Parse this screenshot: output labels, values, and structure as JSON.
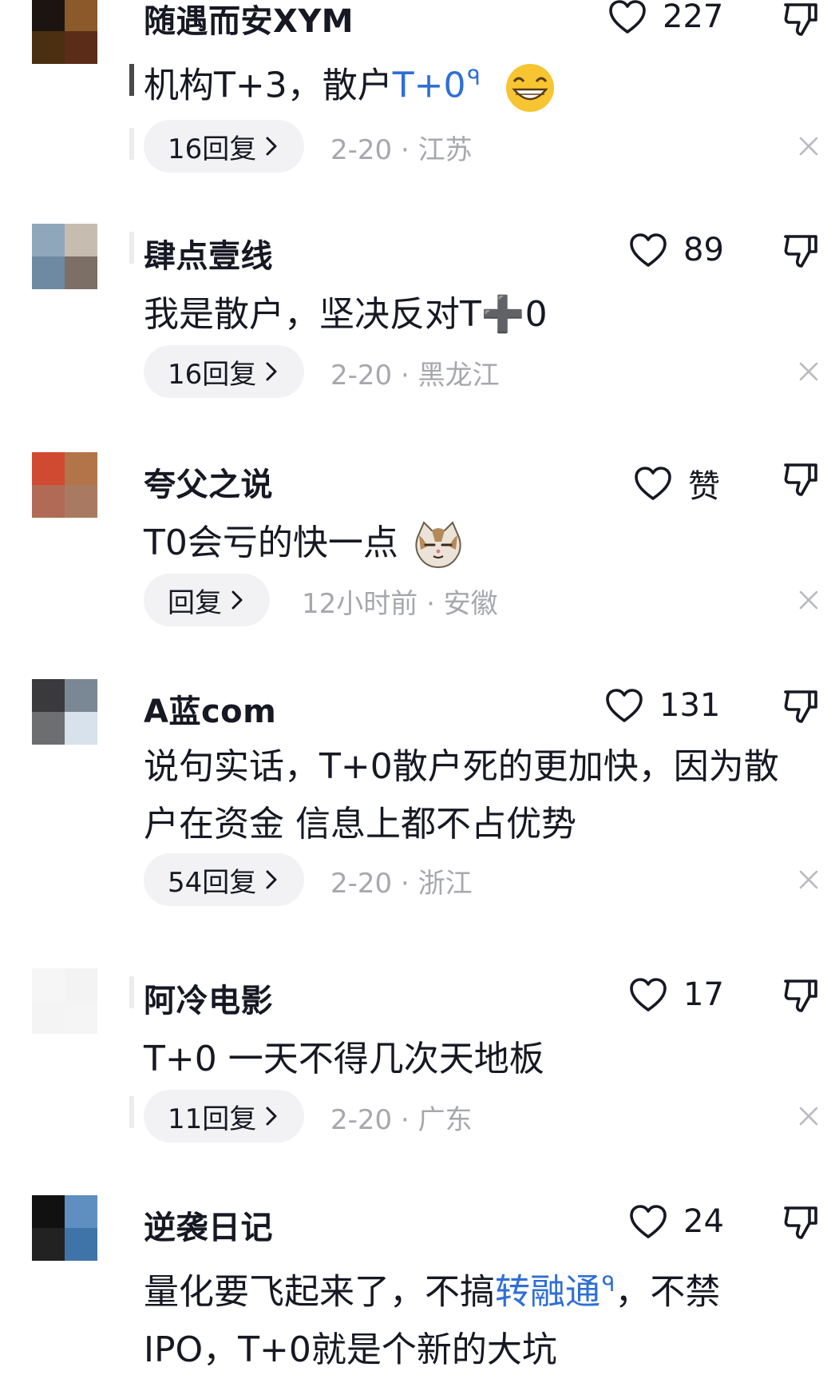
{
  "comments": [
    {
      "username": "随遇而安XYM",
      "likes": "227",
      "text_parts": [
        "机构T+3，散户",
        "T+0"
      ],
      "text_search_mark": "ᑫ",
      "replies": "16回复",
      "date": "2-20 · 江苏",
      "avatar_colors": [
        "#1b1410",
        "#8a5a2a",
        "#4a3010",
        "#5b2d18"
      ],
      "emoji": "grinning-face"
    },
    {
      "username": "肆点壹线",
      "likes": "89",
      "text": "我是散户，坚决反对T➕0",
      "replies": "16回复",
      "date": "2-20 · 黑龙江",
      "avatar_colors": [
        "#8fa7bb",
        "#c6bcb0",
        "#6e8aa3",
        "#7b6f66"
      ]
    },
    {
      "username": "夸父之说",
      "likes": "赞",
      "text": "T0会亏的快一点",
      "replies": "回复",
      "date": "12小时前 · 安徽",
      "avatar_colors": [
        "#d04a32",
        "#b2754a",
        "#b06a55",
        "#a97a62"
      ],
      "emoji": "cat-face"
    },
    {
      "username": "A蓝com",
      "likes": "131",
      "text_lines": [
        "说句实话，T+0散户死的更加快，因为散",
        "户在资金 信息上都不占优势"
      ],
      "replies": "54回复",
      "date": "2-20 · 浙江",
      "avatar_colors": [
        "#3a3a3c",
        "#7a8794",
        "#6d6e70",
        "#d7e2ec"
      ]
    },
    {
      "username": "阿冷电影",
      "likes": "17",
      "text": "T+0 一天不得几次天地板",
      "replies": "11回复",
      "date": "2-20 · 广东",
      "avatar_colors": [
        "#f6f6f6",
        "#f3f3f3",
        "#f4f4f4",
        "#f5f5f5"
      ]
    },
    {
      "username": "逆袭日记",
      "likes": "24",
      "text_line1_parts": [
        "量化要飞起来了，不搞",
        "转融通",
        "，不禁"
      ],
      "text_line2": "IPO，T+0就是个新的大坑",
      "avatar_colors": [
        "#111111",
        "#5f8fc0",
        "#222222",
        "#3f74a8"
      ]
    }
  ],
  "icons": {
    "like": "heart-outline-icon",
    "dislike": "thumbs-down-icon",
    "close": "close-icon",
    "chevron": "chevron-right-icon"
  },
  "colors": {
    "link": "#2f6fd6",
    "meta": "#a6a8ad",
    "pill": "#f2f2f4"
  }
}
